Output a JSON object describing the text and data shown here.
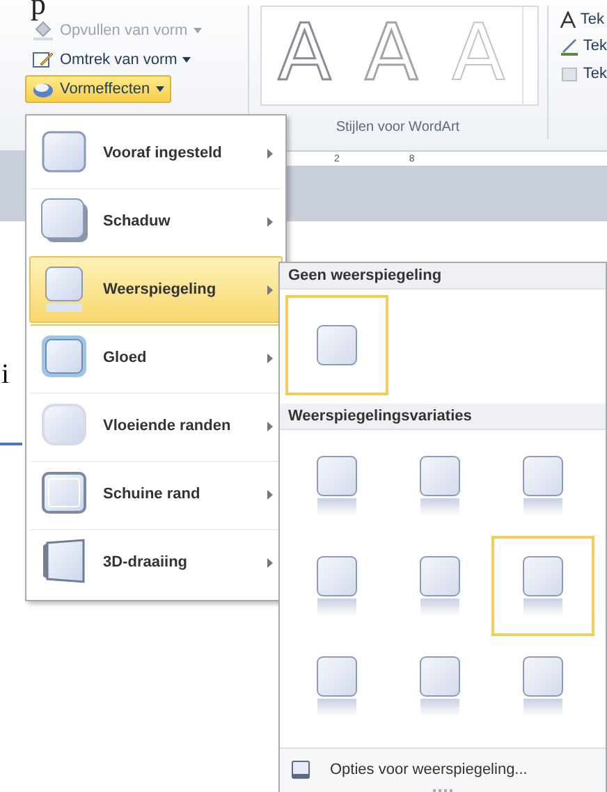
{
  "document": {
    "title_fragment": "p",
    "text_fragment": "i"
  },
  "ribbon": {
    "shape_buttons": [
      {
        "label": "Opvullen van vorm",
        "kind": "fill",
        "disabled": true,
        "selected": false
      },
      {
        "label": "Omtrek van vorm",
        "kind": "outline",
        "disabled": false,
        "selected": false
      },
      {
        "label": "Vormeffecten",
        "kind": "effects",
        "disabled": false,
        "selected": true
      }
    ],
    "wordart_group": {
      "label": "Stijlen voor WordArt",
      "styles": [
        "A",
        "A",
        "A"
      ]
    },
    "text_buttons": [
      {
        "label": "Tek",
        "kind": "letter"
      },
      {
        "label": "Tek",
        "kind": "pen"
      },
      {
        "label": "Tek",
        "kind": "box"
      }
    ],
    "ruler_labels": [
      "2",
      "8"
    ]
  },
  "effects_menu": {
    "items": [
      {
        "label": "Vooraf ingesteld",
        "kind": "preset",
        "selected": false
      },
      {
        "label": "Schaduw",
        "kind": "shadow",
        "selected": false
      },
      {
        "label": "Weerspiegeling",
        "kind": "reflection",
        "selected": true
      },
      {
        "label": "Gloed",
        "kind": "glow",
        "selected": false
      },
      {
        "label": "Vloeiende randen",
        "kind": "soft",
        "selected": false
      },
      {
        "label": "Schuine rand",
        "kind": "bevel",
        "selected": false
      },
      {
        "label": "3D-draaiing",
        "kind": "rotation",
        "selected": false
      }
    ]
  },
  "reflection_submenu": {
    "sections": [
      {
        "heading": "Geen weerspiegeling",
        "items": [
          {
            "kind": "none",
            "selected": true
          }
        ]
      },
      {
        "heading": "Weerspiegelingsvariaties",
        "items": [
          {
            "kind": "reflect",
            "selected": false
          },
          {
            "kind": "reflect",
            "selected": false
          },
          {
            "kind": "reflect",
            "selected": false
          },
          {
            "kind": "reflect",
            "selected": false
          },
          {
            "kind": "reflect",
            "selected": false
          },
          {
            "kind": "reflect",
            "selected": true
          },
          {
            "kind": "reflect",
            "selected": false
          },
          {
            "kind": "reflect",
            "selected": false
          },
          {
            "kind": "reflect",
            "selected": false
          }
        ]
      }
    ],
    "options_label": "Opties voor weerspiegeling..."
  }
}
